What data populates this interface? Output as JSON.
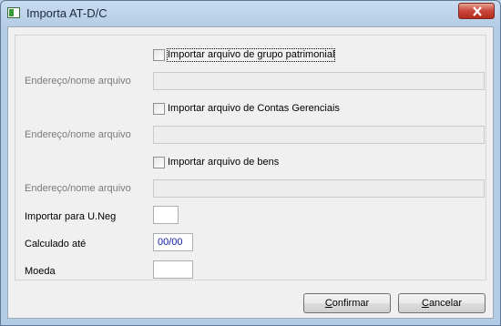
{
  "window": {
    "title": "Importa AT-D/C"
  },
  "form": {
    "check_grupo": {
      "label": "Importar arquivo de grupo patrimonial",
      "checked": false
    },
    "endereco1": {
      "label": "Endereço/nome arquivo",
      "value": ""
    },
    "check_contas": {
      "label": "Importar arquivo de Contas Gerenciais",
      "checked": false
    },
    "endereco2": {
      "label": "Endereço/nome arquivo",
      "value": ""
    },
    "check_bens": {
      "label": "Importar arquivo de bens",
      "checked": false
    },
    "endereco3": {
      "label": "Endereço/nome arquivo",
      "value": ""
    },
    "importar_para": {
      "label": "Importar para U.Neg",
      "value": ""
    },
    "calculado_ate": {
      "label": "Calculado até",
      "value": "00/00"
    },
    "moeda": {
      "label": "Moeda",
      "value": ""
    }
  },
  "buttons": {
    "confirmar": {
      "first": "C",
      "rest": "onfirmar"
    },
    "cancelar": {
      "first": "C",
      "rest": "ancelar"
    }
  }
}
